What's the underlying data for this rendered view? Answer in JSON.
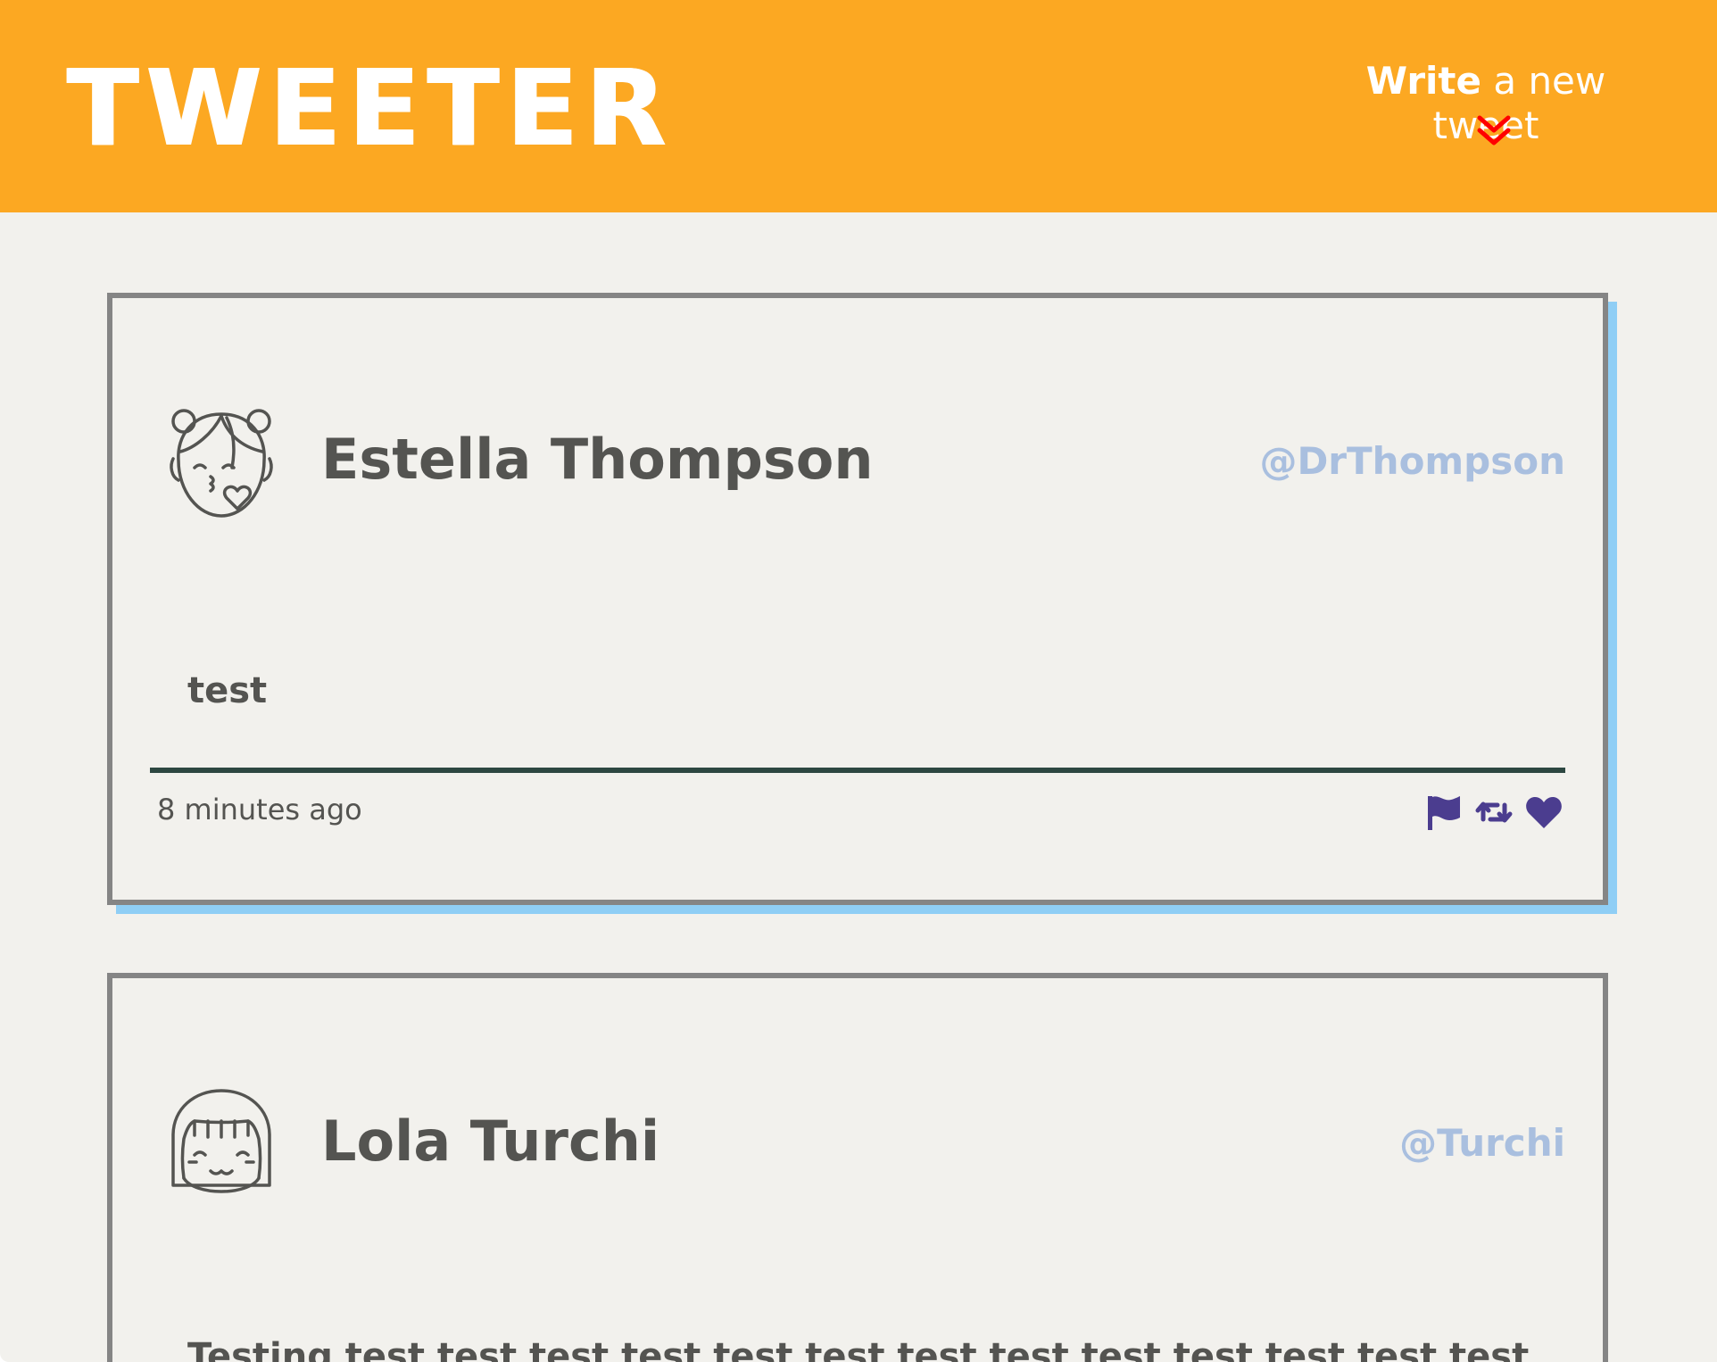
{
  "app": {
    "brand": "TWEETER",
    "compose_strong": "Write",
    "compose_rest": " a new tweet",
    "chevron_icon": "double-chevron-down-icon",
    "colors": {
      "header": "#fca822",
      "background": "#f2f1ed",
      "handle": "#a9bfdf",
      "action_icons": "#4b3d8f",
      "chevron": "#ff0000",
      "card_shadow": "#8fcef5"
    }
  },
  "tweets": [
    {
      "avatar_icon": "girl-kiss-avatar-icon",
      "name": "Estella Thompson",
      "handle": "@DrThompson",
      "content": "test",
      "timestamp": "8 minutes ago",
      "actions": [
        "flag-icon",
        "retweet-icon",
        "heart-icon"
      ]
    },
    {
      "avatar_icon": "girl-smile-avatar-icon",
      "name": "Lola Turchi",
      "handle": "@Turchi",
      "content": "Testing test test test test test test test test test test test test test"
    }
  ]
}
